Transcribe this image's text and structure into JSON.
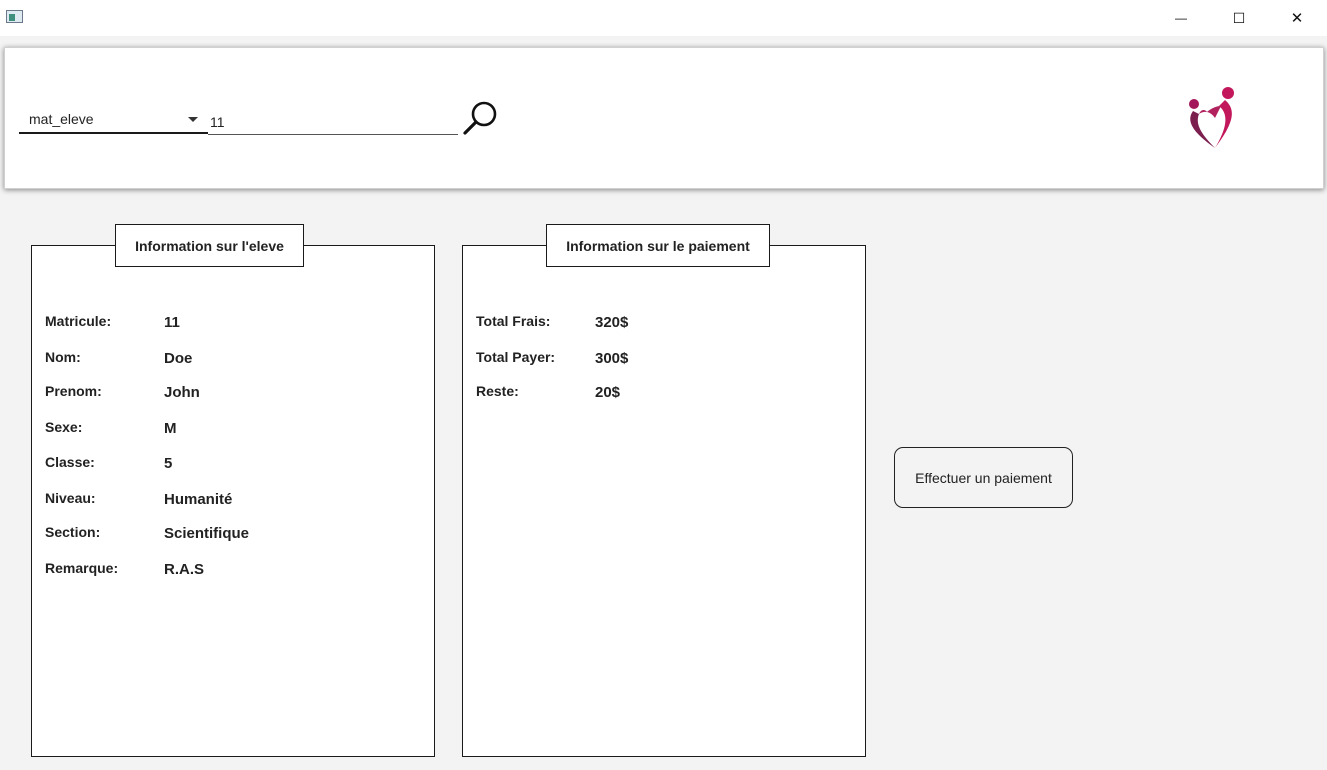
{
  "window": {
    "controls": {
      "minimize": "—",
      "maximize": "☐",
      "close": "✕"
    }
  },
  "search": {
    "field_select": "mat_eleve",
    "query_value": "11",
    "search_icon": "magnifier-icon"
  },
  "logo": {
    "icon": "heart-people-logo",
    "colors": [
      "#c2185b",
      "#7b1f4f"
    ]
  },
  "student_panel": {
    "title": "Information sur l'eleve",
    "fields": [
      {
        "label": "Matricule:",
        "value": "11"
      },
      {
        "label": "Nom:",
        "value": "Doe"
      },
      {
        "label": "Prenom:",
        "value": "John"
      },
      {
        "label": "Sexe:",
        "value": "M"
      },
      {
        "label": "Classe:",
        "value": "5"
      },
      {
        "label": "Niveau:",
        "value": "Humanité"
      },
      {
        "label": "Section:",
        "value": "Scientifique"
      },
      {
        "label": "Remarque:",
        "value": "R.A.S"
      }
    ]
  },
  "payment_panel": {
    "title": "Information sur le paiement",
    "fields": [
      {
        "label": "Total Frais:",
        "value": "320$"
      },
      {
        "label": "Total Payer:",
        "value": "300$"
      },
      {
        "label": "Reste:",
        "value": "20$"
      }
    ]
  },
  "actions": {
    "pay_button": "Effectuer un paiement"
  }
}
